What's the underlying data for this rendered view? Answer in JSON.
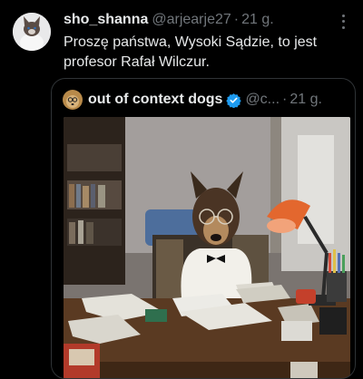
{
  "tweet": {
    "display_name": "sho_shanna",
    "handle": "@arjearje27",
    "separator": "·",
    "time": "21 g.",
    "text": "Proszę państwa, Wysoki Sądzie, to jest profesor Rafał Wilczur."
  },
  "quote": {
    "display_name": "out of context dogs",
    "handle": "@c...",
    "separator": "·",
    "time": "21 g."
  },
  "colors": {
    "background": "#000000",
    "text_primary": "#e7e9ea",
    "text_secondary": "#71767b",
    "verified_badge": "#1d9bf0",
    "border": "#2f3336"
  },
  "icons": {
    "more": "more-vertical-icon",
    "verified": "verified-badge-icon"
  }
}
